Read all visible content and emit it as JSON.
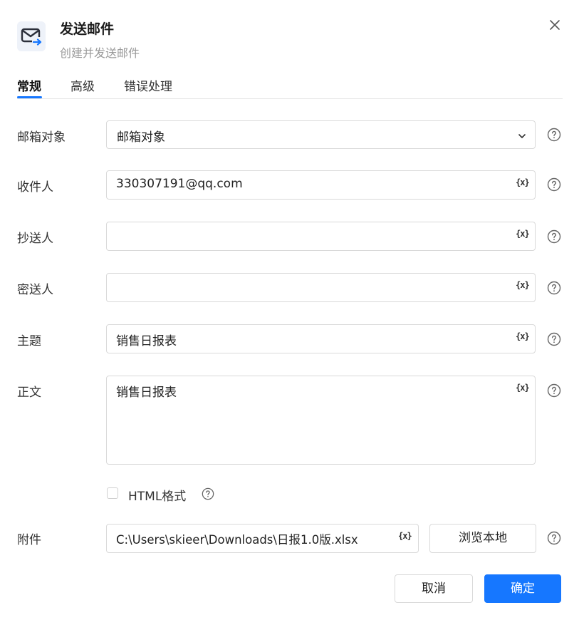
{
  "dialog": {
    "title": "发送邮件",
    "subtitle": "创建并发送邮件",
    "icon": "mail-send-icon"
  },
  "tabs": [
    {
      "label": "常规",
      "active": true
    },
    {
      "label": "高级",
      "active": false
    },
    {
      "label": "错误处理",
      "active": false
    }
  ],
  "form": {
    "mailbox": {
      "label": "邮箱对象",
      "value": "邮箱对象"
    },
    "to": {
      "label": "收件人",
      "value": "330307191@qq.com"
    },
    "cc": {
      "label": "抄送人",
      "value": ""
    },
    "bcc": {
      "label": "密送人",
      "value": ""
    },
    "subject": {
      "label": "主题",
      "value": "销售日报表"
    },
    "body": {
      "label": "正文",
      "value": "销售日报表"
    },
    "html_format": {
      "label": "HTML格式",
      "checked": false
    },
    "attachment": {
      "label": "附件",
      "value": "C:\\Users\\skieer\\Downloads\\日报1.0版.xlsx",
      "browse_label": "浏览本地"
    }
  },
  "variable_icon_text": "{x}",
  "footer": {
    "cancel_label": "取消",
    "confirm_label": "确定"
  },
  "colors": {
    "accent": "#1677ff",
    "border": "#d9d9d9",
    "muted": "#9a9a9a"
  }
}
